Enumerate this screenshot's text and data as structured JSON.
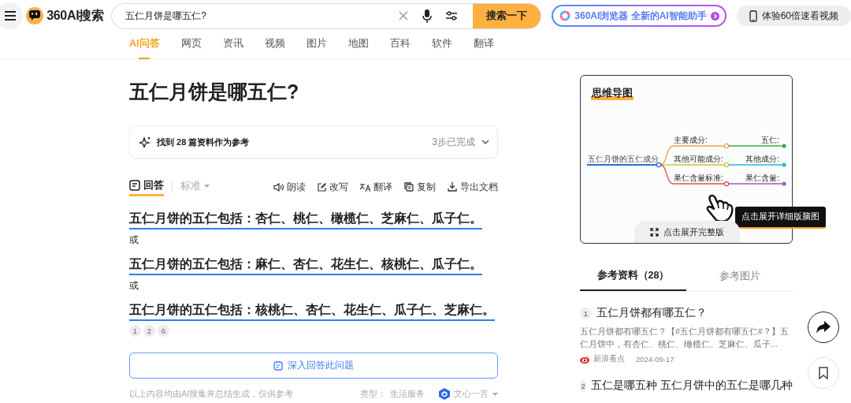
{
  "header": {
    "logo_text": "360AI搜索",
    "search_value": "五仁月饼是哪五仁?",
    "search_button": "搜索一下",
    "promo": "360AI浏览器 全新的AI智能助手",
    "video_button": "体验60倍速看视频"
  },
  "tabs": [
    {
      "label": "AI问答",
      "selected": true
    },
    {
      "label": "网页",
      "selected": false
    },
    {
      "label": "资讯",
      "selected": false
    },
    {
      "label": "视频",
      "selected": false
    },
    {
      "label": "图片",
      "selected": false
    },
    {
      "label": "地图",
      "selected": false
    },
    {
      "label": "百科",
      "selected": false
    },
    {
      "label": "软件",
      "selected": false
    },
    {
      "label": "翻译",
      "selected": false
    }
  ],
  "question": "五仁月饼是哪五仁?",
  "sources_bar": {
    "text": "找到 28 篇资料作为参考",
    "status": "3步已完成"
  },
  "answer_modes": [
    {
      "label": "回答",
      "selected": true,
      "kind": "tab"
    },
    {
      "label": "标准",
      "selected": false,
      "kind": "dropdown"
    }
  ],
  "answer_actions": [
    {
      "label": "朗读",
      "kind": "read"
    },
    {
      "label": "改写",
      "kind": "rewrite"
    },
    {
      "label": "翻译",
      "kind": "translate"
    },
    {
      "label": "复制",
      "kind": "copy"
    },
    {
      "label": "导出文档",
      "kind": "export"
    }
  ],
  "answer_lines": [
    {
      "kind": "statement",
      "text": "五仁月饼的五仁包括：杏仁、桃仁、橄榄仁、芝麻仁、瓜子仁。"
    },
    {
      "kind": "separator",
      "text": "或"
    },
    {
      "kind": "statement",
      "text": "五仁月饼的五仁包括：麻仁、杏仁、花生仁、核桃仁、瓜子仁。"
    },
    {
      "kind": "separator",
      "text": "或"
    },
    {
      "kind": "statement",
      "text": "五仁月饼的五仁包括：核桃仁、杏仁、花生仁、瓜子仁、芝麻仁。"
    }
  ],
  "citations": [
    "1",
    "2",
    "6"
  ],
  "deep_button": "深入回答此问题",
  "footer": {
    "disclaimer": "以上内容均由AI搜集并总结生成，仅供参考",
    "type_label": "类型：",
    "type_value": "生活服务",
    "model": "文心一言"
  },
  "mind_map": {
    "title": "思维导图",
    "root": "五仁月饼的五仁成分",
    "branches": [
      {
        "label": "主要成分:",
        "color": "#f5a04a",
        "leaf": {
          "label": "五仁:",
          "color": "#3aaa3a"
        }
      },
      {
        "label": "其他可能成分:",
        "color": "#c8c23a",
        "leaf": {
          "label": "其他成分:",
          "color": "#22b8d8"
        }
      },
      {
        "label": "果仁含量标准:",
        "color": "#e0504a",
        "leaf": {
          "label": "果仁含量:",
          "color": "#9a5cc8"
        }
      }
    ],
    "tooltip": "点击展开详细版脑图",
    "expand_button": "点击展开完整版"
  },
  "ref_tabs": [
    {
      "label": "参考资料（28）",
      "selected": true
    },
    {
      "label": "参考图片",
      "selected": false
    }
  ],
  "references": [
    {
      "index": "1",
      "title": "五仁月饼都有哪五仁？",
      "snippet": "五仁月饼都有哪五仁？【#五仁月饼都有哪五仁#？】五仁月饼中，有杏仁、桃仁、橄榄仁、芝麻仁、瓜子...",
      "source": "新浪看点",
      "date": "2024-09-17"
    },
    {
      "index": "2",
      "title": "五仁是哪五种 五仁月饼中的五仁是哪几种"
    }
  ]
}
